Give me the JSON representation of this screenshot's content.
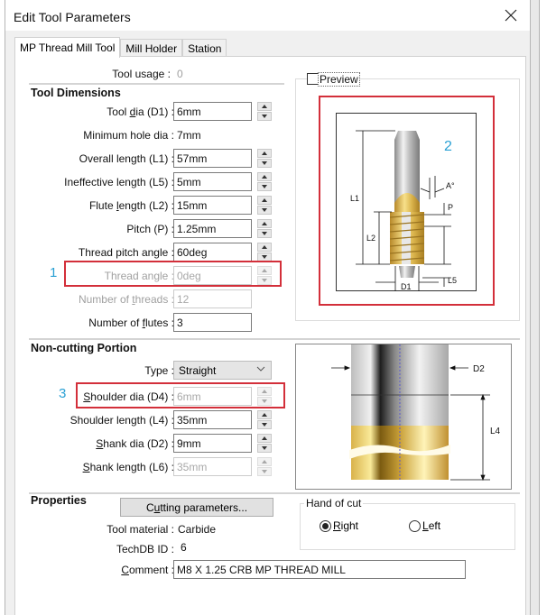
{
  "window": {
    "title": "Edit Tool Parameters"
  },
  "tabs": [
    {
      "label": "MP Thread Mill Tool",
      "active": true
    },
    {
      "label": "Mill Holder",
      "active": false
    },
    {
      "label": "Station",
      "active": false
    }
  ],
  "tool_usage": {
    "label": "Tool usage :",
    "value": "0"
  },
  "tool_dimensions": {
    "heading": "Tool Dimensions",
    "tool_dia": {
      "label_pre": "Tool ",
      "label_ul": "d",
      "label_post": "ia (D1) :",
      "value": "6mm"
    },
    "min_hole_dia": {
      "label": "Minimum hole dia :",
      "value": "7mm"
    },
    "overall_length": {
      "label": "Overall length (L1) :",
      "value": "57mm"
    },
    "ineffective_length": {
      "label": "Ineffective length (L5) :",
      "value": "5mm"
    },
    "flute_length": {
      "label_pre": "Flute ",
      "label_ul": "l",
      "label_post": "ength (L2) :",
      "value": "15mm"
    },
    "pitch": {
      "label": "Pitch (P) :",
      "value": "1.25mm"
    },
    "thread_pitch_angle": {
      "label": "Thread pitch angle :",
      "value": "60deg"
    },
    "thread_angle": {
      "label": "Thread angle :",
      "value": "0deg",
      "disabled": true
    },
    "number_of_threads": {
      "label_pre": "Number of ",
      "label_ul": "t",
      "label_post": "hreads :",
      "value": "12",
      "disabled": true
    },
    "number_of_flutes": {
      "label_pre": "Number of ",
      "label_ul": "f",
      "label_post": "lutes :",
      "value": "3"
    }
  },
  "preview": {
    "label": "Preview",
    "checked": false
  },
  "diagram_top": {
    "labels": {
      "l1": "L1",
      "l2": "L2",
      "l5": "L5",
      "d1": "D1",
      "p": "P",
      "a": "A°"
    }
  },
  "diagram_bottom": {
    "labels": {
      "d2": "D2",
      "l4": "L4"
    }
  },
  "callouts": [
    "1",
    "2",
    "3"
  ],
  "non_cutting": {
    "heading": "Non-cutting Portion",
    "type": {
      "label": "Type :",
      "value": "Straight"
    },
    "shoulder_dia": {
      "label_pre": "",
      "label_ul": "S",
      "label_post": "houlder dia (D4) :",
      "value": "6mm",
      "disabled": true
    },
    "shoulder_length": {
      "label": "Shoulder length (L4) :",
      "value": "35mm"
    },
    "shank_dia": {
      "label_pre": "",
      "label_ul": "S",
      "label_post": "hank dia (D2) :",
      "value": "9mm"
    },
    "shank_length": {
      "label_pre": "",
      "label_ul": "S",
      "label_post": "hank length (L6) :",
      "value": "35mm",
      "disabled": true
    }
  },
  "properties": {
    "heading": "Properties",
    "cutting_params_button": {
      "label_pre": "C",
      "label_ul": "u",
      "label_post": "tting parameters..."
    },
    "tool_material": {
      "label": "Tool material :",
      "value": "Carbide"
    },
    "techdb_id": {
      "label": "TechDB ID :",
      "value": "6"
    },
    "comment": {
      "label_pre": "",
      "label_ul": "C",
      "label_post": "omment :",
      "value": "M8 X 1.25 CRB MP THREAD MILL"
    }
  },
  "hand_of_cut": {
    "label": "Hand of cut",
    "options": [
      {
        "label_ul": "R",
        "label_post": "ight",
        "selected": true
      },
      {
        "label_ul": "L",
        "label_post": "eft",
        "selected": false
      }
    ]
  },
  "colors": {
    "highlight_red": "#d32f3a",
    "callout_blue": "#2aa0d4",
    "gold": "#d9b24a"
  }
}
